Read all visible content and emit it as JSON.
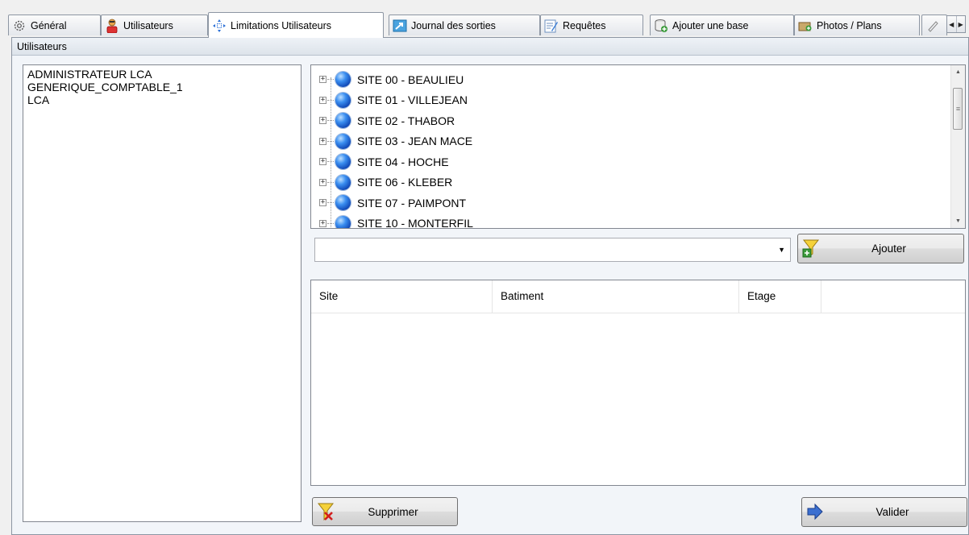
{
  "tabs": [
    {
      "label": "Général",
      "icon": "gear-icon"
    },
    {
      "label": "Utilisateurs",
      "icon": "user-icon"
    },
    {
      "label": "Limitations Utilisateurs",
      "icon": "move-arrows-icon"
    },
    {
      "label": "Journal des sorties",
      "icon": "export-icon"
    },
    {
      "label": "Requêtes",
      "icon": "query-icon"
    },
    {
      "label": "Ajouter une base",
      "icon": "add-database-icon"
    },
    {
      "label": "Photos / Plans",
      "icon": "photos-icon"
    }
  ],
  "group_title": "Utilisateurs",
  "users": [
    "ADMINISTRATEUR LCA",
    "GENERIQUE_COMPTABLE_1",
    "LCA"
  ],
  "sites": [
    "SITE 00 - BEAULIEU",
    "SITE 01 - VILLEJEAN",
    "SITE 02 - THABOR",
    "SITE 03 - JEAN MACE",
    "SITE 04 - HOCHE",
    "SITE 06 - KLEBER",
    "SITE 07 - PAIMPONT",
    "SITE 10 - MONTERFIL"
  ],
  "combo": {
    "value": ""
  },
  "buttons": {
    "add": "Ajouter",
    "delete": "Supprimer",
    "validate": "Valider"
  },
  "columns": [
    "Site",
    "Batiment",
    "Etage"
  ]
}
